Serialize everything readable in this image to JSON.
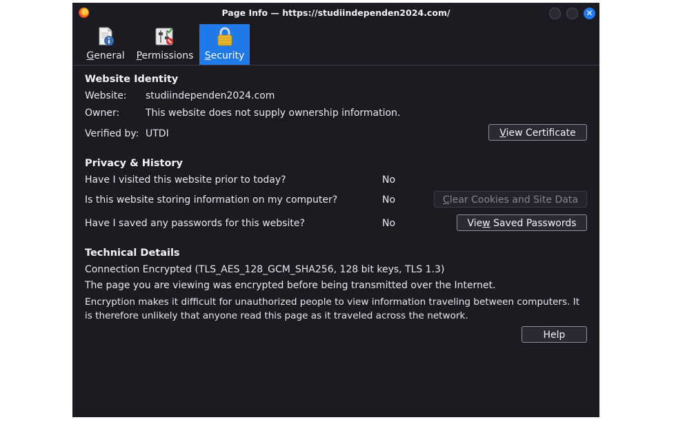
{
  "window": {
    "title": "Page Info — https://studiindependen2024.com/"
  },
  "tabs": [
    {
      "label_first": "G",
      "label_rest": "eneral",
      "icon": "page-info-icon"
    },
    {
      "label_first": "P",
      "label_rest": "ermissions",
      "icon": "permissions-icon"
    },
    {
      "label_first": "S",
      "label_rest": "ecurity",
      "icon": "padlock-icon",
      "selected": true
    }
  ],
  "identity": {
    "heading": "Website Identity",
    "website_label": "Website:",
    "website_value": "studiindependen2024.com",
    "owner_label": "Owner:",
    "owner_value": "This website does not supply ownership information.",
    "verified_label": "Verified by:",
    "verified_value": "UTDI",
    "view_cert_pre": "",
    "view_cert_u": "V",
    "view_cert_post": "iew Certificate"
  },
  "privacy": {
    "heading": "Privacy & History",
    "q1": "Have I visited this website prior to today?",
    "a1": "No",
    "q2": "Is this website storing information on my computer?",
    "a2": "No",
    "q3": "Have I saved any passwords for this website?",
    "a3": "No",
    "clear_u": "C",
    "clear_post": "lear Cookies and Site Data",
    "saved_pre": "Vie",
    "saved_u": "w",
    "saved_post": " Saved Passwords"
  },
  "technical": {
    "heading": "Technical Details",
    "connection": "Connection Encrypted (TLS_AES_128_GCM_SHA256, 128 bit keys, TLS 1.3)",
    "line2": "The page you are viewing was encrypted before being transmitted over the Internet.",
    "line3": "Encryption makes it difficult for unauthorized people to view information traveling between computers. It is therefore unlikely that anyone read this page as it traveled across the network.",
    "help": "Help"
  },
  "colors": {
    "background": "#1c1b22",
    "accent": "#1f7ae8",
    "close_button": "#1f7aeb"
  }
}
